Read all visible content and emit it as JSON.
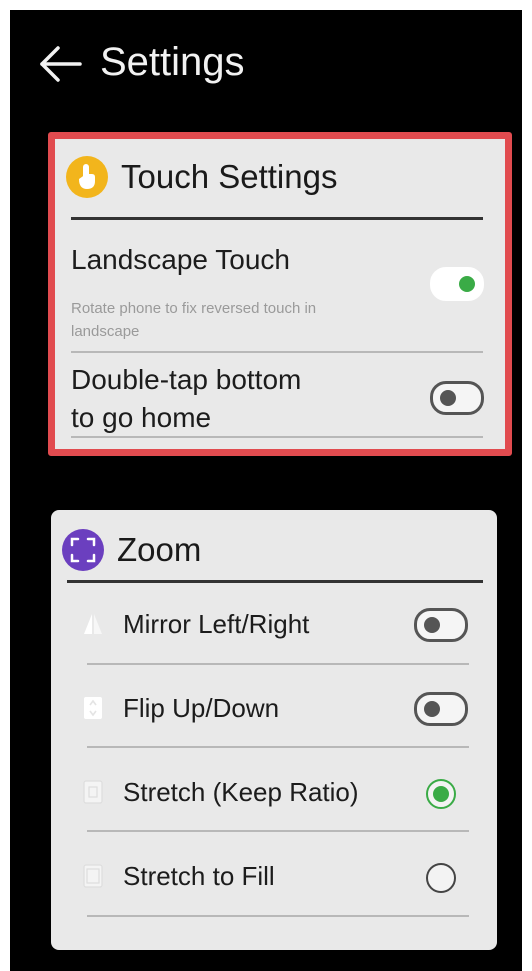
{
  "header": {
    "title": "Settings"
  },
  "touch_settings": {
    "title": "Touch Settings",
    "landscape_touch": {
      "title": "Landscape Touch",
      "subtitle_line1": "Rotate phone to fix reversed touch in",
      "subtitle_line2": "landscape",
      "enabled": true
    },
    "double_tap": {
      "title_line1": "Double-tap bottom",
      "title_line2": "to go home",
      "enabled": false
    }
  },
  "zoom": {
    "title": "Zoom",
    "options": [
      {
        "label": "Mirror Left/Right",
        "control": "toggle",
        "on": false
      },
      {
        "label": "Flip Up/Down",
        "control": "toggle",
        "on": false
      },
      {
        "label": "Stretch (Keep Ratio)",
        "control": "radio",
        "selected": true
      },
      {
        "label": "Stretch to Fill",
        "control": "radio",
        "selected": false
      }
    ]
  },
  "colors": {
    "highlight_border": "#e14b4f",
    "accent_green": "#3aab46",
    "touch_icon": "#f2b51c",
    "zoom_icon": "#6b3fbf"
  },
  "icons": {
    "back": "arrow-left-icon",
    "touch": "touch-hand-icon",
    "zoom": "expand-icon"
  }
}
